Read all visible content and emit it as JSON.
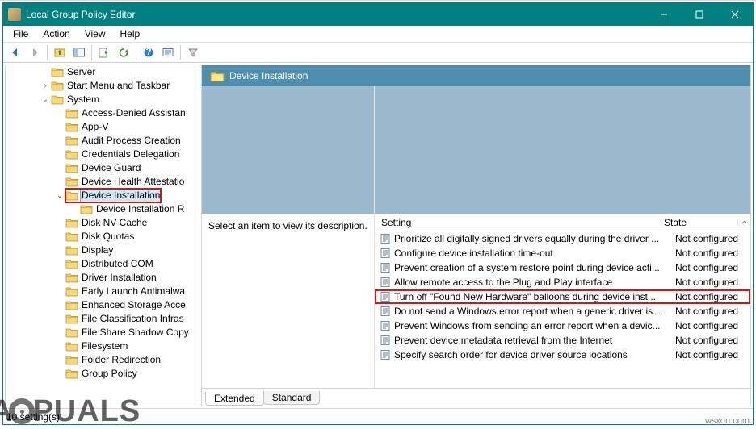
{
  "titlebar": {
    "title": "Local Group Policy Editor"
  },
  "menubar": {
    "file": "File",
    "action": "Action",
    "view": "View",
    "help": "Help"
  },
  "tree": {
    "items": [
      {
        "lvl": 1,
        "exp": "",
        "name": "Server"
      },
      {
        "lvl": 1,
        "exp": ">",
        "name": "Start Menu and Taskbar"
      },
      {
        "lvl": 1,
        "exp": "v",
        "name": "System"
      },
      {
        "lvl": 2,
        "exp": "",
        "name": "Access-Denied Assistan"
      },
      {
        "lvl": 2,
        "exp": "",
        "name": "App-V"
      },
      {
        "lvl": 2,
        "exp": "",
        "name": "Audit Process Creation"
      },
      {
        "lvl": 2,
        "exp": "",
        "name": "Credentials Delegation"
      },
      {
        "lvl": 2,
        "exp": "",
        "name": "Device Guard"
      },
      {
        "lvl": 2,
        "exp": "",
        "name": "Device Health Attestatio"
      },
      {
        "lvl": 2,
        "exp": "v",
        "name": "Device Installation",
        "sel": true,
        "hl": true
      },
      {
        "lvl": 3,
        "exp": "",
        "name": "Device Installation R"
      },
      {
        "lvl": 2,
        "exp": "",
        "name": "Disk NV Cache"
      },
      {
        "lvl": 2,
        "exp": "",
        "name": "Disk Quotas"
      },
      {
        "lvl": 2,
        "exp": "",
        "name": "Display"
      },
      {
        "lvl": 2,
        "exp": "",
        "name": "Distributed COM"
      },
      {
        "lvl": 2,
        "exp": "",
        "name": "Driver Installation"
      },
      {
        "lvl": 2,
        "exp": "",
        "name": "Early Launch Antimalwa"
      },
      {
        "lvl": 2,
        "exp": "",
        "name": "Enhanced Storage Acce"
      },
      {
        "lvl": 2,
        "exp": "",
        "name": "File Classification Infras"
      },
      {
        "lvl": 2,
        "exp": "",
        "name": "File Share Shadow Copy"
      },
      {
        "lvl": 2,
        "exp": "",
        "name": "Filesystem"
      },
      {
        "lvl": 2,
        "exp": "",
        "name": "Folder Redirection"
      },
      {
        "lvl": 2,
        "exp": "",
        "name": "Group Policy"
      }
    ]
  },
  "header": {
    "title": "Device Installation"
  },
  "desc": {
    "prompt": "Select an item to view its description."
  },
  "columns": {
    "setting": "Setting",
    "state": "State"
  },
  "settings": [
    {
      "name": "Prioritize all digitally signed drivers equally during the driver ...",
      "state": "Not configured"
    },
    {
      "name": "Configure device installation time-out",
      "state": "Not configured"
    },
    {
      "name": "Prevent creation of a system restore point during device acti...",
      "state": "Not configured"
    },
    {
      "name": "Allow remote access to the Plug and Play interface",
      "state": "Not configured"
    },
    {
      "name": "Turn off \"Found New Hardware\" balloons during device inst...",
      "state": "Not configured",
      "hl": true
    },
    {
      "name": "Do not send a Windows error report when a generic driver is...",
      "state": "Not configured"
    },
    {
      "name": "Prevent Windows from sending an error report when a devic...",
      "state": "Not configured"
    },
    {
      "name": "Prevent device metadata retrieval from the Internet",
      "state": "Not configured"
    },
    {
      "name": "Specify search order for device driver source locations",
      "state": "Not configured"
    }
  ],
  "tabs": {
    "extended": "Extended",
    "standard": "Standard"
  },
  "status": {
    "count": "10 setting(s)"
  },
  "watermark": {
    "site": "wsxdn.com"
  }
}
